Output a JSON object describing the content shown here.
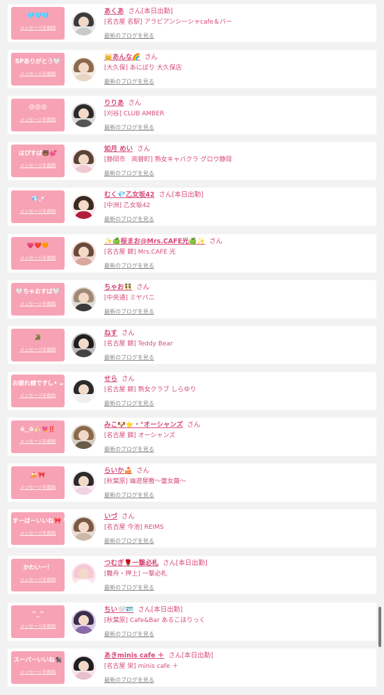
{
  "common": {
    "reply_label": "メッセージを削除",
    "blog_link": "最新のブログを見る",
    "honorific": "さん"
  },
  "entries": [
    {
      "message": "🩵🩵🩵",
      "name": "あくあ",
      "suffix": "さん[本日出勤]",
      "store": "[名古屋 名駅] アラビアンシーシャcafe＆バー",
      "avatar_hair": "#3b3b3b",
      "avatar_body": "#c9c9c9",
      "avatar_bg": "#e9e9e9"
    },
    {
      "message": "SPありがとう🤍",
      "name": "👑あんな🌈",
      "suffix": "さん",
      "store": "[大久保] あにぼり 大久保店",
      "avatar_hair": "#8a6a4f",
      "avatar_body": "#e8d6c4",
      "avatar_bg": "#f4ece4"
    },
    {
      "message": "😝😝😝",
      "name": "りりあ",
      "suffix": "さん",
      "store": "[刈谷] CLUB AMBER",
      "avatar_hair": "#2b2b2b",
      "avatar_body": "#555555",
      "avatar_bg": "#d9d9d9"
    },
    {
      "message": "はぴすぱ🐻💕",
      "name": "如月 めい",
      "suffix": "さん",
      "store": "[静岡市　両替町] 熟女キャバクラ グロウ静岡",
      "avatar_hair": "#5a4436",
      "avatar_body": "#f1c9d2",
      "avatar_bg": "#f7e8ec"
    },
    {
      "message": "💎.*",
      "name": "むく💎乙女坂42",
      "suffix": "さん[本日出勤]",
      "store": "[中洲] 乙女坂42",
      "avatar_hair": "#3a2a22",
      "avatar_body": "#b31d3c",
      "avatar_bg": "#fbeaea"
    },
    {
      "message": "💗❤️🧡",
      "name": "✨🍏桜まお@Mrs.CAFE光🍏✨",
      "suffix": "さん",
      "store": "[名古屋 錦] Mrs.CAFE 光",
      "avatar_hair": "#6a4a3a",
      "avatar_body": "#d9a7a0",
      "avatar_bg": "#efd6cf"
    },
    {
      "message": "🤍ちゃおすば🤍",
      "name": "ちゃお👯",
      "suffix": "さん",
      "store": "[中央通] ミヤバニ",
      "avatar_hair": "#a08a74",
      "avatar_body": "#3a3a3a",
      "avatar_bg": "#e1dcd6"
    },
    {
      "message": "🐊",
      "name": "ねす",
      "suffix": "さん",
      "store": "[名古屋 錦] Teddy Bear",
      "avatar_hair": "#1f1f1f",
      "avatar_body": "#444444",
      "avatar_bg": "#bdbdbd"
    },
    {
      "message": "お疲れ様です(｡• ᴗ •｡)",
      "name": "せら",
      "suffix": "さん",
      "store": "[名古屋 錦] 熟女クラブ しらゆり",
      "avatar_hair": "#2a2a2a",
      "avatar_body": "#efefef",
      "avatar_bg": "#f5f5f5"
    },
    {
      "message": "ó‿ò👍🏻💘‼️",
      "name": "みこ🐶⭐️・°オーシャンズ",
      "suffix": "さん",
      "store": "[名古屋 錦] オーシャンズ",
      "avatar_hair": "#8a6a4a",
      "avatar_body": "#6a5a4a",
      "avatar_bg": "#d8cfc4"
    },
    {
      "message": "🍰🎀",
      "name": "らいか🍰",
      "suffix": "さん",
      "store": "[秋葉原] 幽遊屋敷〜蕾女繭〜",
      "avatar_hair": "#2b2b2b",
      "avatar_body": "#f2d3e2",
      "avatar_bg": "#f8e9f1"
    },
    {
      "message": "すーぱーいいね🎀 ⁾",
      "name": "いづ",
      "suffix": "さん",
      "store": "[名古屋 今池] REIMS",
      "avatar_hair": "#7a5a44",
      "avatar_body": "#cdb8a8",
      "avatar_bg": "#e6ddd4"
    },
    {
      "message": "かわいー！",
      "name": "つむぎ🌹一撃必札",
      "suffix": "さん[本日出勤]",
      "store": "[難舟・押上] 一撃必札",
      "avatar_hair": "#f5c9d4",
      "avatar_body": "#ffffff",
      "avatar_bg": "#fce6ec"
    },
    {
      "message": "^_^",
      "name": "ちい🤍🪪",
      "suffix": "さん[本日出勤]",
      "store": "[秋葉原] Cafe&Bar あるこほりっく",
      "avatar_hair": "#3a2e4a",
      "avatar_body": "#8a6aa8",
      "avatar_bg": "#d8cbe6"
    },
    {
      "message": "スーパーいいね🐈‍⬛",
      "name": "あきminis cafe ＋",
      "suffix": "さん[本日出勤]",
      "store": "[名古屋 栄] minis cafe ＋",
      "avatar_hair": "#1f1f1f",
      "avatar_body": "#e8c0cc",
      "avatar_bg": "#f6e4ea"
    }
  ]
}
